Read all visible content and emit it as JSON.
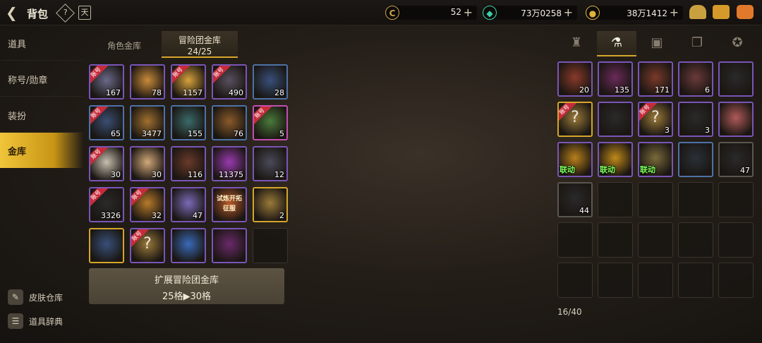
{
  "header": {
    "title": "背包",
    "back_icon": "back-arrow-icon",
    "help_glyph": "?",
    "book_glyph": "天"
  },
  "currencies": [
    {
      "icon": "gold-coin-c-icon",
      "glyph": "C",
      "value": "52",
      "color": "#c9a248"
    },
    {
      "icon": "green-gem-icon",
      "glyph": "◆",
      "value": "73万0258",
      "color": "#3fd0a8"
    },
    {
      "icon": "gold-coin-icon",
      "glyph": "●",
      "value": "38万1412",
      "color": "#e0b33a"
    }
  ],
  "sidebar": {
    "items": [
      {
        "label": "道具",
        "active": false
      },
      {
        "label": "称号/勋章",
        "active": false
      },
      {
        "label": "装扮",
        "active": false
      },
      {
        "label": "金库",
        "active": true
      }
    ],
    "bottom": [
      {
        "icon": "broom-icon",
        "label": "皮肤仓库"
      },
      {
        "icon": "pencil-book-icon",
        "label": "道具辞典"
      }
    ]
  },
  "vault": {
    "tabs": {
      "character": "角色金库",
      "adventure_title": "冒险团金库",
      "adventure_count": "24/25"
    },
    "expand": {
      "line1": "扩展冒险团金库",
      "line2": "25格▶30格"
    },
    "items": [
      {
        "count": "167",
        "acct": "账号",
        "rarity": "purple",
        "hue": "#6a6a8a"
      },
      {
        "count": "78",
        "acct": "",
        "rarity": "purple",
        "hue": "#c98b3a"
      },
      {
        "count": "1157",
        "acct": "账号",
        "rarity": "purple",
        "hue": "#d8a23c"
      },
      {
        "count": "490",
        "acct": "账号",
        "rarity": "purple",
        "hue": "#5a5060"
      },
      {
        "count": "28",
        "acct": "",
        "rarity": "blue",
        "hue": "#38507a"
      },
      {
        "count": "65",
        "acct": "账号",
        "rarity": "blue",
        "hue": "#3a4e72"
      },
      {
        "count": "3477",
        "acct": "",
        "rarity": "blue",
        "hue": "#a07030"
      },
      {
        "count": "155",
        "acct": "",
        "rarity": "blue",
        "hue": "#3a6a6a"
      },
      {
        "count": "76",
        "acct": "",
        "rarity": "blue",
        "hue": "#8a5a2a"
      },
      {
        "count": "5",
        "acct": "账号",
        "rarity": "pink",
        "hue": "#4a7a3a"
      },
      {
        "count": "30",
        "acct": "账号",
        "rarity": "purple",
        "hue": "#c8c0b0"
      },
      {
        "count": "30",
        "acct": "",
        "rarity": "purple",
        "hue": "#d2a87a"
      },
      {
        "count": "116",
        "acct": "",
        "rarity": "purple",
        "hue": "#6a3a2a"
      },
      {
        "count": "11375",
        "acct": "",
        "rarity": "purple",
        "hue": "#9a3ab0"
      },
      {
        "count": "12",
        "acct": "",
        "rarity": "purple",
        "hue": "#4a4a5a"
      },
      {
        "count": "3326",
        "acct": "账号",
        "rarity": "purple",
        "hue": "#2a2a2a"
      },
      {
        "count": "32",
        "acct": "账号",
        "rarity": "purple",
        "hue": "#b87a2a"
      },
      {
        "count": "47",
        "acct": "",
        "rarity": "purple",
        "hue": "#7a6ab8"
      },
      {
        "count": "",
        "acct": "",
        "rarity": "purple",
        "hue": "#b85a2a",
        "text": "试炼开拓 征服"
      },
      {
        "count": "2",
        "acct": "",
        "rarity": "gold",
        "hue": "#9a7a3a"
      },
      {
        "count": "",
        "acct": "",
        "rarity": "gold",
        "hue": "#38507a"
      },
      {
        "count": "",
        "acct": "账号",
        "rarity": "purple",
        "hue": "#9a7a3a",
        "symbol": "?"
      },
      {
        "count": "",
        "acct": "",
        "rarity": "purple",
        "hue": "#3a6ab8"
      },
      {
        "count": "",
        "acct": "",
        "rarity": "purple",
        "hue": "#6a2a6a"
      }
    ]
  },
  "inventory": {
    "tabs": [
      {
        "icon": "knight-helmet-icon",
        "glyph": "♜"
      },
      {
        "icon": "potion-flask-icon",
        "glyph": "⚗"
      },
      {
        "icon": "material-cube-icon",
        "glyph": "▣"
      },
      {
        "icon": "cards-icon",
        "glyph": "❐"
      },
      {
        "icon": "pentagram-icon",
        "glyph": "✪"
      }
    ],
    "items": [
      {
        "count": "20",
        "acct": "",
        "rarity": "purple",
        "hue": "#8a3a2a"
      },
      {
        "count": "135",
        "acct": "",
        "rarity": "purple",
        "hue": "#6a2a5a"
      },
      {
        "count": "171",
        "acct": "",
        "rarity": "purple",
        "hue": "#7a3a2a"
      },
      {
        "count": "6",
        "acct": "",
        "rarity": "purple",
        "hue": "#6a3a3a"
      },
      {
        "count": "",
        "acct": "",
        "rarity": "purple",
        "hue": "#2a2a2a"
      },
      {
        "count": "",
        "acct": "账号",
        "rarity": "gold",
        "hue": "#9a7a3a",
        "symbol": "?"
      },
      {
        "count": "",
        "acct": "",
        "rarity": "purple",
        "hue": "#2a2a2a"
      },
      {
        "count": "3",
        "acct": "账号",
        "rarity": "purple",
        "hue": "#9a7a3a",
        "symbol": "?"
      },
      {
        "count": "3",
        "acct": "",
        "rarity": "purple",
        "hue": "#2a2a2a"
      },
      {
        "count": "",
        "acct": "",
        "rarity": "purple",
        "hue": "#b05a5a"
      },
      {
        "count": "",
        "acct": "",
        "rarity": "purple",
        "hue": "#b8801a",
        "collab": "联动"
      },
      {
        "count": "",
        "acct": "",
        "rarity": "purple",
        "hue": "#c08a1a",
        "collab": "联动"
      },
      {
        "count": "",
        "acct": "",
        "rarity": "purple",
        "hue": "#7a6a3a",
        "collab": "联动"
      },
      {
        "count": "",
        "acct": "",
        "rarity": "blue",
        "hue": "#2a3038"
      },
      {
        "count": "47",
        "acct": "",
        "rarity": "plain",
        "hue": "#2a2a2a"
      },
      {
        "count": "44",
        "acct": "",
        "rarity": "plain",
        "hue": "#2a2a2a"
      }
    ],
    "capacity": "16/40",
    "total_slots": 30
  }
}
